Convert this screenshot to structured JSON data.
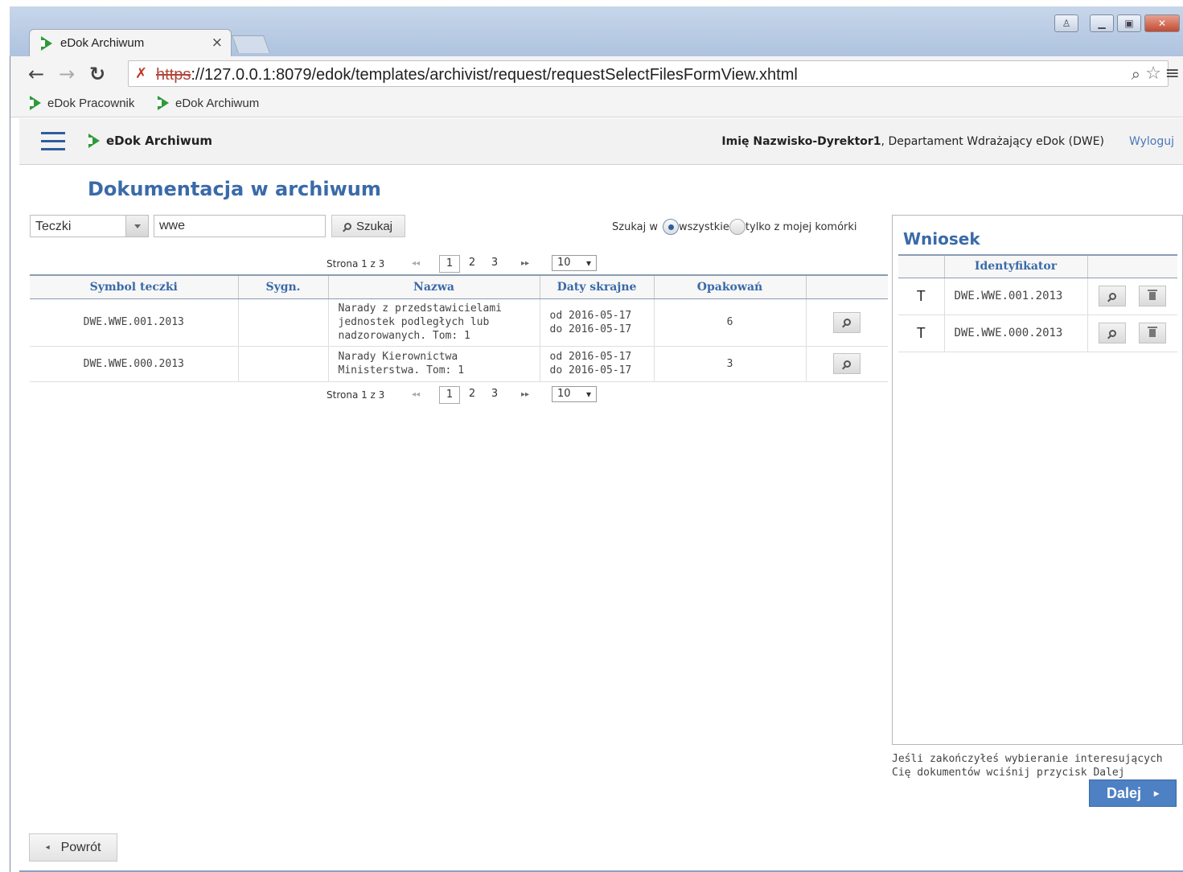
{
  "browser": {
    "tab_title": "eDok Archiwum",
    "tab_close": "×",
    "url_scheme": "https",
    "url_rest": "://127.0.0.1:8079/edok/templates/archivist/request/requestSelectFilesFormView.xhtml",
    "bookmarks": [
      "eDok Pracownik",
      "eDok Archiwum"
    ]
  },
  "header": {
    "app_name": "eDok Archiwum",
    "user_name": "Imię Nazwisko-Dyrektor1",
    "user_dept": ", Departament Wdrażający eDok (DWE)",
    "logout": "Wyloguj"
  },
  "page": {
    "title": "Dokumentacja w archiwum"
  },
  "search": {
    "type_value": "Teczki",
    "query_value": "wwe",
    "search_button": "Szukaj",
    "scope_label": "Szukaj w",
    "scope_all": "wszystkie",
    "scope_mine": "tylko z mojej komórki",
    "scope_selected": "all"
  },
  "pager": {
    "label": "Strona 1 z 3",
    "prev": "◂◂",
    "next": "▸▸",
    "pages": [
      "1",
      "2",
      "3"
    ],
    "current": "1",
    "rows_per_page": "10"
  },
  "results": {
    "columns": [
      "Symbol teczki",
      "Sygn.",
      "Nazwa",
      "Daty skrajne",
      "Opakowań",
      ""
    ],
    "rows": [
      {
        "symbol": "DWE.WWE.001.2013",
        "sygn": "",
        "name": "Narady z przedstawicielami jednostek podległych lub nadzorowanych. Tom: 1",
        "date_from": "od 2016-05-17",
        "date_to": "do 2016-05-17",
        "packages": "6"
      },
      {
        "symbol": "DWE.WWE.000.2013",
        "sygn": "",
        "name": "Narady Kierownictwa Ministerstwa. Tom: 1",
        "date_from": "od 2016-05-17",
        "date_to": "do 2016-05-17",
        "packages": "3"
      }
    ]
  },
  "request_panel": {
    "title": "Wniosek",
    "columns": [
      "",
      "Identyfikator",
      ""
    ],
    "rows": [
      {
        "type": "T",
        "id": "DWE.WWE.001.2013"
      },
      {
        "type": "T",
        "id": "DWE.WWE.000.2013"
      }
    ]
  },
  "footer": {
    "hint": "Jeśli zakończyłeś wybieranie interesujących Cię dokumentów wciśnij przycisk Dalej",
    "next_button": "Dalej",
    "back_button": "Powrót"
  },
  "colors": {
    "accent_blue": "#3a6aa8",
    "primary_button": "#4e80c4",
    "brand_green": "#2f9a3a"
  }
}
